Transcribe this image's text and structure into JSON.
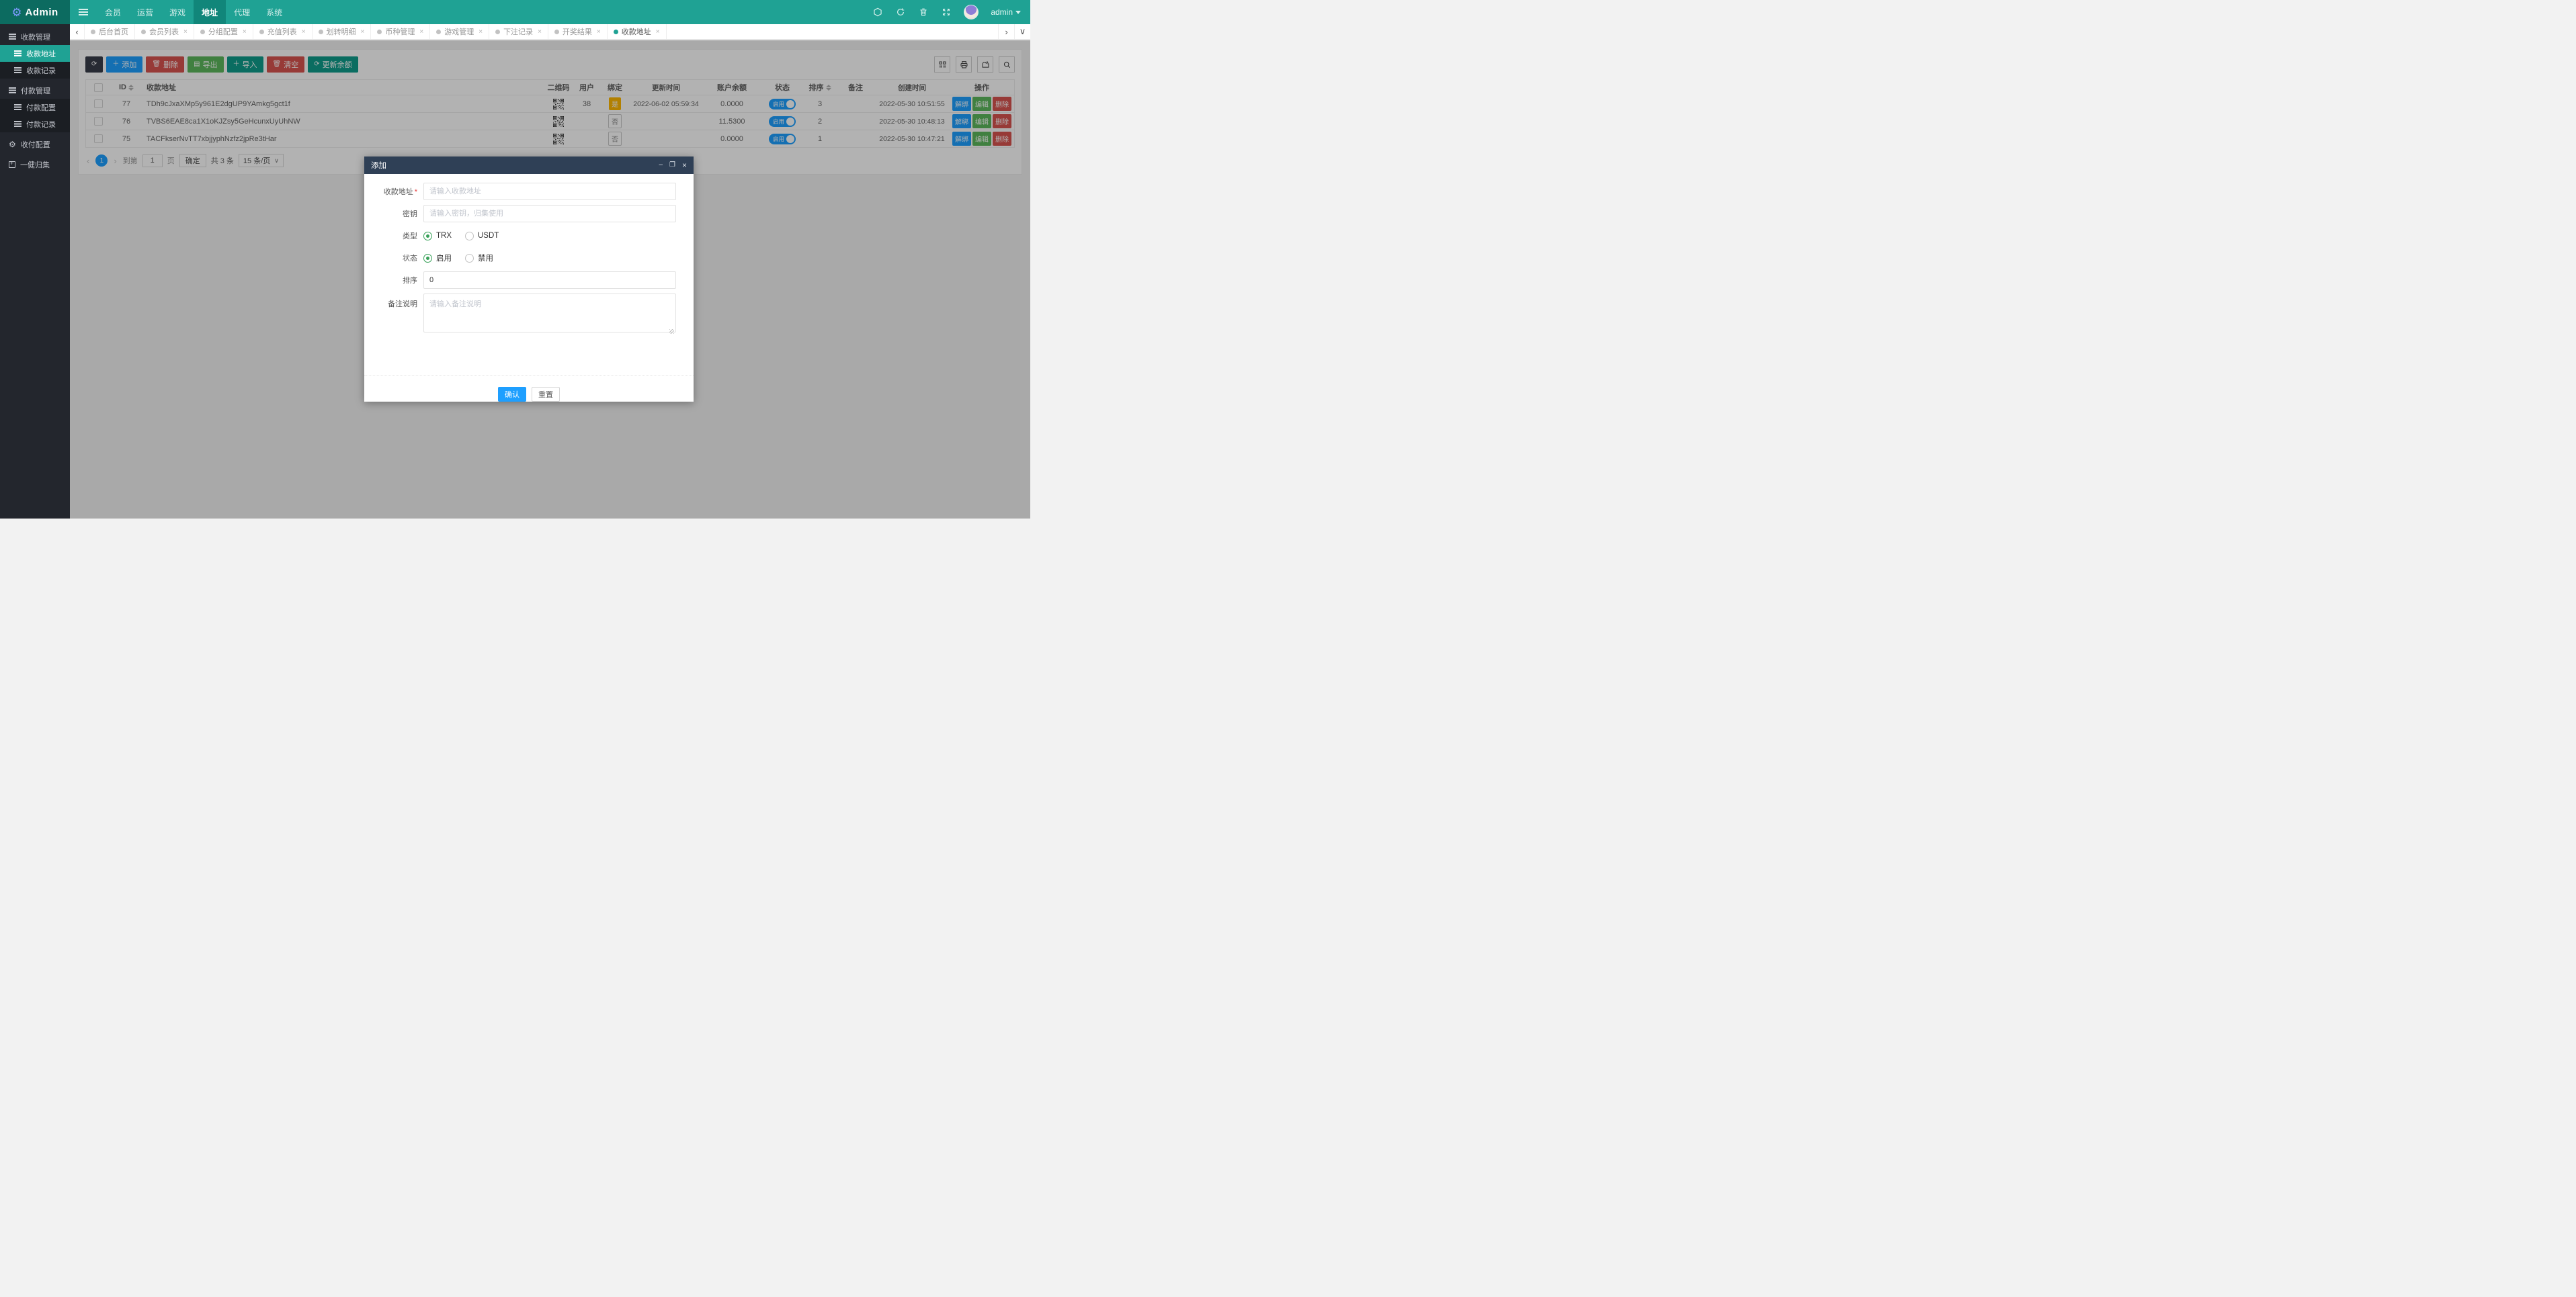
{
  "colors": {
    "accent_teal": "#1FA294",
    "navbar_logo_bg": "#0C6B60",
    "sidebar_bg": "#23262D",
    "blue": "#1E9FFF",
    "green": "#5CB85C",
    "red": "#D9534F",
    "dark_teal": "#0F9D8B",
    "dark_btn": "#393D49",
    "warn_orange": "#FFB800",
    "modal_header_bg": "#2F4056"
  },
  "navbar": {
    "logo_text": "Admin",
    "menu": [
      {
        "label": "会员",
        "active": false
      },
      {
        "label": "运营",
        "active": false
      },
      {
        "label": "游戏",
        "active": false
      },
      {
        "label": "地址",
        "active": true
      },
      {
        "label": "代理",
        "active": false
      },
      {
        "label": "系统",
        "active": false
      }
    ],
    "right_icons": [
      "hexagon-icon",
      "refresh-icon",
      "trash-icon",
      "fullscreen-icon"
    ],
    "user_name": "admin"
  },
  "sidebar": {
    "items": [
      {
        "label": "收款管理",
        "kind": "group",
        "icon": "list"
      },
      {
        "label": "收款地址",
        "kind": "sub",
        "icon": "list",
        "active": true
      },
      {
        "label": "收款记录",
        "kind": "sub",
        "icon": "list"
      },
      {
        "label": "付款管理",
        "kind": "group",
        "icon": "list"
      },
      {
        "label": "付款配置",
        "kind": "sub",
        "icon": "list"
      },
      {
        "label": "付款记录",
        "kind": "sub",
        "icon": "list"
      },
      {
        "label": "收付配置",
        "kind": "group",
        "icon": "gear"
      },
      {
        "label": "一健归集",
        "kind": "group",
        "icon": "calendar"
      }
    ]
  },
  "tabs": {
    "items": [
      {
        "label": "后台首页",
        "closable": false,
        "active": false
      },
      {
        "label": "会员列表",
        "closable": true,
        "active": false
      },
      {
        "label": "分组配置",
        "closable": true,
        "active": false
      },
      {
        "label": "充值列表",
        "closable": true,
        "active": false
      },
      {
        "label": "划转明细",
        "closable": true,
        "active": false
      },
      {
        "label": "币种管理",
        "closable": true,
        "active": false
      },
      {
        "label": "游戏管理",
        "closable": true,
        "active": false
      },
      {
        "label": "下注记录",
        "closable": true,
        "active": false
      },
      {
        "label": "开奖结果",
        "closable": true,
        "active": false
      },
      {
        "label": "收款地址",
        "closable": true,
        "active": true
      }
    ],
    "close_glyph": "×"
  },
  "toolbar": {
    "buttons": [
      {
        "label": "",
        "icon": "refresh",
        "color": "#393D49",
        "name": "refresh-button"
      },
      {
        "label": "添加",
        "icon": "plus",
        "color": "#1E9FFF",
        "name": "add-button"
      },
      {
        "label": "删除",
        "icon": "trash",
        "color": "#D9534F",
        "name": "delete-button"
      },
      {
        "label": "导出",
        "icon": "file",
        "color": "#5CB85C",
        "name": "export-button"
      },
      {
        "label": "导入",
        "icon": "plus",
        "color": "#0F9D8B",
        "name": "import-button"
      },
      {
        "label": "清空",
        "icon": "trash",
        "color": "#D9534F",
        "name": "clear-button"
      },
      {
        "label": "更新余额",
        "icon": "refresh",
        "color": "#0F9D8B",
        "name": "update-balance-button"
      }
    ],
    "icon_buttons": [
      "columns-icon",
      "print-icon",
      "export-data-icon",
      "search-icon"
    ]
  },
  "table": {
    "columns": [
      "ID",
      "收款地址",
      "二维码",
      "用户",
      "绑定",
      "更新时间",
      "账户余额",
      "状态",
      "排序",
      "备注",
      "创建时间",
      "操作"
    ],
    "status_on_label": "启用",
    "op_labels": [
      "解绑",
      "编辑",
      "删除"
    ],
    "op_colors": [
      "#1E9FFF",
      "#5CB85C",
      "#D9534F"
    ],
    "rows": [
      {
        "id": "77",
        "address": "TDh9cJxaXMp5y961E2dgUP9YAmkg5gct1f",
        "user": "38",
        "bound": "是",
        "updated": "2022-06-02 05:59:34",
        "balance": "0.0000",
        "status": "启用",
        "sort": "3",
        "remark": "",
        "created": "2022-05-30 10:51:55"
      },
      {
        "id": "76",
        "address": "TVBS6EAE8ca1X1oKJZsy5GeHcunxUyUhNW",
        "user": "",
        "bound": "否",
        "updated": "",
        "balance": "11.5300",
        "status": "启用",
        "sort": "2",
        "remark": "",
        "created": "2022-05-30 10:48:13"
      },
      {
        "id": "75",
        "address": "TACFkserNvTT7xbjjyphNzfz2jpRe3tHar",
        "user": "",
        "bound": "否",
        "updated": "",
        "balance": "0.0000",
        "status": "启用",
        "sort": "1",
        "remark": "",
        "created": "2022-05-30 10:47:21"
      }
    ]
  },
  "pagination": {
    "prev": "‹",
    "next": "›",
    "current_page": "1",
    "goto_label": "到第",
    "goto_value": "1",
    "page_label": "页",
    "confirm_label": "确定",
    "total_label": "共 3 条",
    "page_size_label": "15 条/页"
  },
  "modal": {
    "title": "添加",
    "fields": [
      {
        "label": "收款地址",
        "required": true,
        "type": "input",
        "placeholder": "请输入收款地址",
        "value": ""
      },
      {
        "label": "密钥",
        "required": false,
        "type": "input",
        "placeholder": "请输入密钥，归集使用",
        "value": ""
      },
      {
        "label": "类型",
        "type": "radio",
        "options": [
          "TRX",
          "USDT"
        ],
        "selected": "TRX"
      },
      {
        "label": "状态",
        "type": "radio",
        "options": [
          "启用",
          "禁用"
        ],
        "selected": "启用"
      },
      {
        "label": "排序",
        "required": false,
        "type": "input",
        "placeholder": "",
        "value": "0"
      },
      {
        "label": "备注说明",
        "type": "textarea",
        "placeholder": "请输入备注说明",
        "value": ""
      }
    ],
    "confirm_label": "确认",
    "reset_label": "重置"
  }
}
